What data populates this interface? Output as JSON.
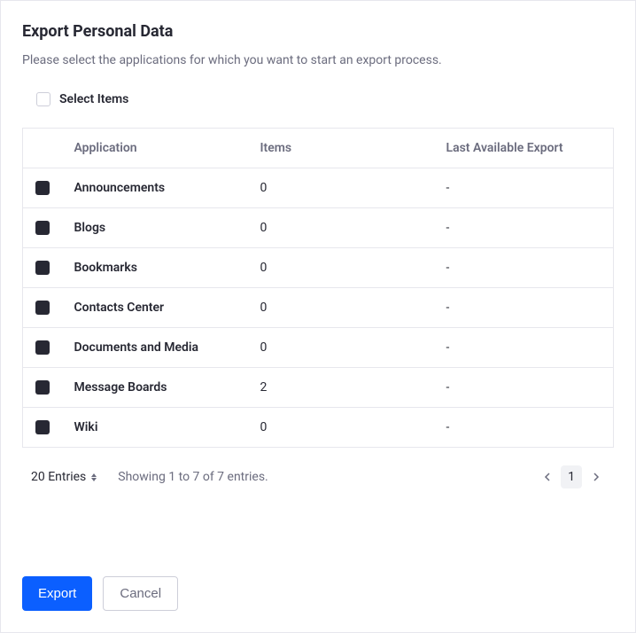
{
  "title": "Export Personal Data",
  "description": "Please select the applications for which you want to start an export process.",
  "selectItemsLabel": "Select Items",
  "headers": {
    "application": "Application",
    "items": "Items",
    "lastExport": "Last Available Export"
  },
  "rows": [
    {
      "application": "Announcements",
      "items": "0",
      "lastExport": "-"
    },
    {
      "application": "Blogs",
      "items": "0",
      "lastExport": "-"
    },
    {
      "application": "Bookmarks",
      "items": "0",
      "lastExport": "-"
    },
    {
      "application": "Contacts Center",
      "items": "0",
      "lastExport": "-"
    },
    {
      "application": "Documents and Media",
      "items": "0",
      "lastExport": "-"
    },
    {
      "application": "Message Boards",
      "items": "2",
      "lastExport": "-"
    },
    {
      "application": "Wiki",
      "items": "0",
      "lastExport": "-"
    }
  ],
  "pagination": {
    "entriesLabel": "20 Entries",
    "showingText": "Showing 1 to 7 of 7 entries.",
    "currentPage": "1"
  },
  "buttons": {
    "export": "Export",
    "cancel": "Cancel"
  }
}
